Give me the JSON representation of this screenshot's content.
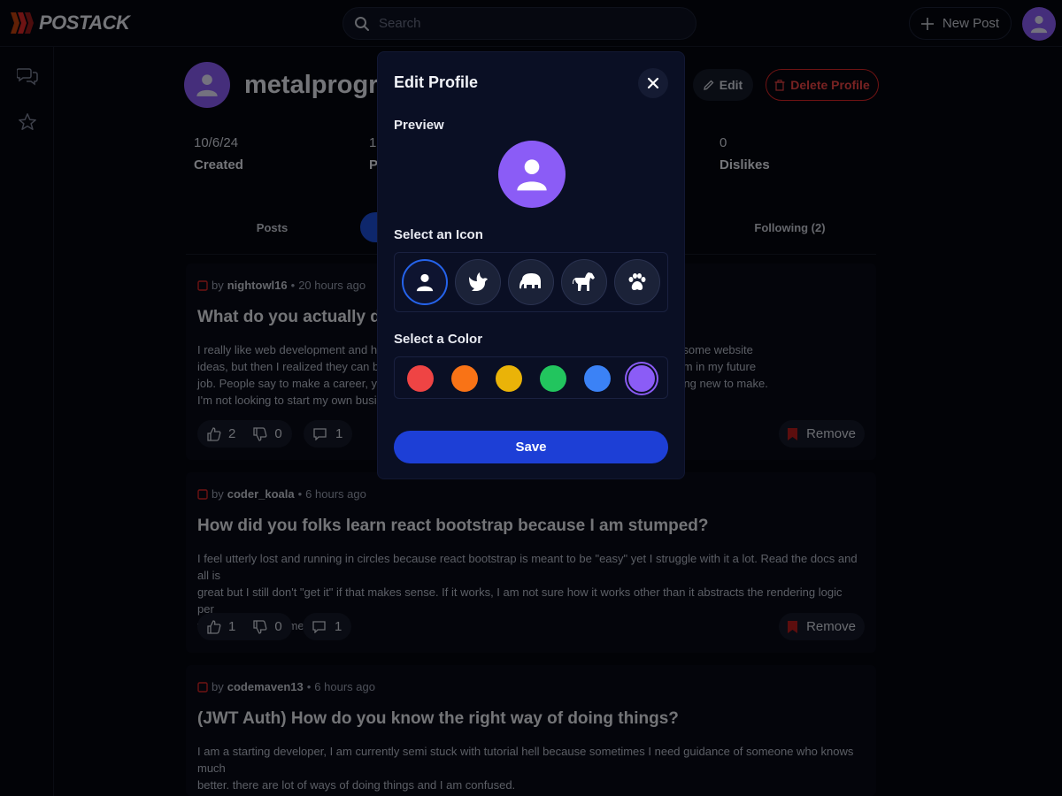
{
  "header": {
    "logo_text": "POSTACK",
    "search_placeholder": "Search",
    "new_post_label": "New Post"
  },
  "profile": {
    "username": "metalprogra",
    "edit_label": "Edit",
    "delete_label": "Delete Profile",
    "stats": [
      {
        "value": "10/6/24",
        "label": "Created"
      },
      {
        "value": "1",
        "label": "Po"
      },
      {
        "value": "0",
        "label": "Dislikes"
      }
    ],
    "tabs": [
      {
        "label": "Posts"
      },
      {
        "label": "Following (2)"
      }
    ]
  },
  "posts": [
    {
      "by": "by",
      "author": "nightowl16",
      "sep": "•",
      "time": "20 hours ago",
      "title": "What do you actually do",
      "body_lines": [
        "I really like web development and hav                                                              make. I thought of some website",
        "ideas, but then I realized they can be                                                              on't want to use them in my future",
        "job. People say to make a career, you                                                               an't think of anything new to make.",
        "I'm not looking to start my own busin"
      ],
      "likes": "2",
      "dislikes": "0",
      "comments": "1",
      "remove_label": "Remove"
    },
    {
      "by": "by",
      "author": "coder_koala",
      "sep": "•",
      "time": "6 hours ago",
      "title": "How did you folks learn react bootstrap because I am stumped?",
      "body_lines": [
        "I feel utterly lost and running in circles because react bootstrap is meant to be \"easy\" yet I struggle with it a lot. Read the docs and all is",
        "great but I still don't \"get it\" if that makes sense. If it works, I am not sure how it works other than it abstracts the rendering logic per",
        "window size or something"
      ],
      "likes": "1",
      "dislikes": "0",
      "comments": "1",
      "remove_label": "Remove"
    },
    {
      "by": "by",
      "author": "codemaven13",
      "sep": "•",
      "time": "6 hours ago",
      "title": "(JWT Auth) How do you know the right way of doing things?",
      "body_lines": [
        "I am a starting developer, I am currently semi stuck with tutorial hell because sometimes I need guidance of someone who knows much",
        "better. there are lot of ways of doing things and I am confused."
      ]
    }
  ],
  "modal": {
    "title": "Edit Profile",
    "preview_label": "Preview",
    "icon_label": "Select an Icon",
    "color_label": "Select a Color",
    "save_label": "Save",
    "icons": [
      "person-icon",
      "dove-icon",
      "elephant-icon",
      "horse-icon",
      "paw-icon"
    ],
    "selected_icon": "person-icon",
    "colors": [
      "#ef4444",
      "#f97316",
      "#eab308",
      "#22c55e",
      "#3b82f6",
      "#8b5cf6"
    ],
    "selected_color": "#8b5cf6"
  },
  "colors": {
    "accent": "#1d4ed8",
    "danger": "#ef4444",
    "avatar": "#8b5cf6"
  }
}
